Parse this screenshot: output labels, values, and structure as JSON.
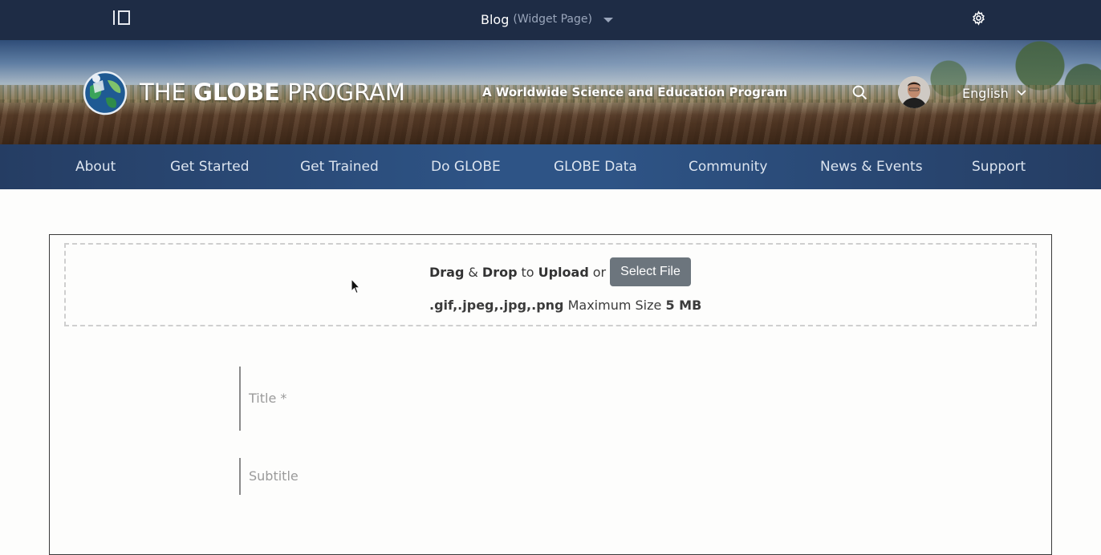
{
  "topbar": {
    "page_title": "Blog",
    "page_type": "(Widget Page)"
  },
  "header": {
    "brand_prefix": "THE ",
    "brand_bold": "GLOBE",
    "brand_suffix": " PROGRAM",
    "tagline": "A Worldwide Science and Education Program",
    "language": "English"
  },
  "nav": {
    "items": [
      "About",
      "Get Started",
      "Get Trained",
      "Do GLOBE",
      "GLOBE Data",
      "Community",
      "News & Events",
      "Support"
    ]
  },
  "upload": {
    "drag": "Drag",
    "amp": "&",
    "drop": "Drop",
    "to": "to",
    "upload": "Upload",
    "or": "or",
    "select_file": "Select File",
    "formats": ".gif,.jpeg,.jpg,.png",
    "max_label": "Maximum Size",
    "max_value": "5 MB"
  },
  "form": {
    "title_placeholder": "Title *",
    "subtitle_placeholder": "Subtitle"
  },
  "colors": {
    "topbar_bg": "#1e2c45",
    "nav_bg": "#2e5486",
    "button_gray": "#6c757d"
  },
  "icons": {
    "sidebar": "sidebar-toggle-icon",
    "caret": "caret-down-icon",
    "gear": "gear-icon",
    "search": "search-icon",
    "chevron": "chevron-down-icon"
  }
}
